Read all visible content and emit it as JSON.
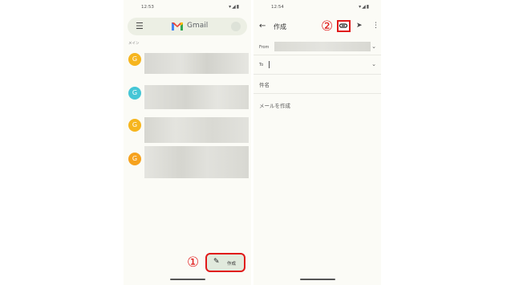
{
  "inbox": {
    "status_time": "12:53",
    "status_icons": "▾◢▮",
    "search_logo_text": "Gmail",
    "section_label": "メイン",
    "emails": [
      {
        "avatar_letter": "G",
        "avatar_color": "#f6b51e"
      },
      {
        "avatar_letter": "G",
        "avatar_color": "#45c6d6"
      },
      {
        "avatar_letter": "G",
        "avatar_color": "#f6b51e"
      },
      {
        "avatar_letter": "G",
        "avatar_color": "#f6a21e"
      }
    ],
    "compose_label": "作成",
    "callout": "①"
  },
  "compose": {
    "status_time": "12:54",
    "status_icons": "▾◢▮",
    "title": "作成",
    "callout": "②",
    "from_label": "From",
    "to_label": "To",
    "subject_placeholder": "件名",
    "body_placeholder": "メールを作成"
  },
  "colors": {
    "highlight": "#e01919",
    "fab_bg": "#e1eadd"
  }
}
